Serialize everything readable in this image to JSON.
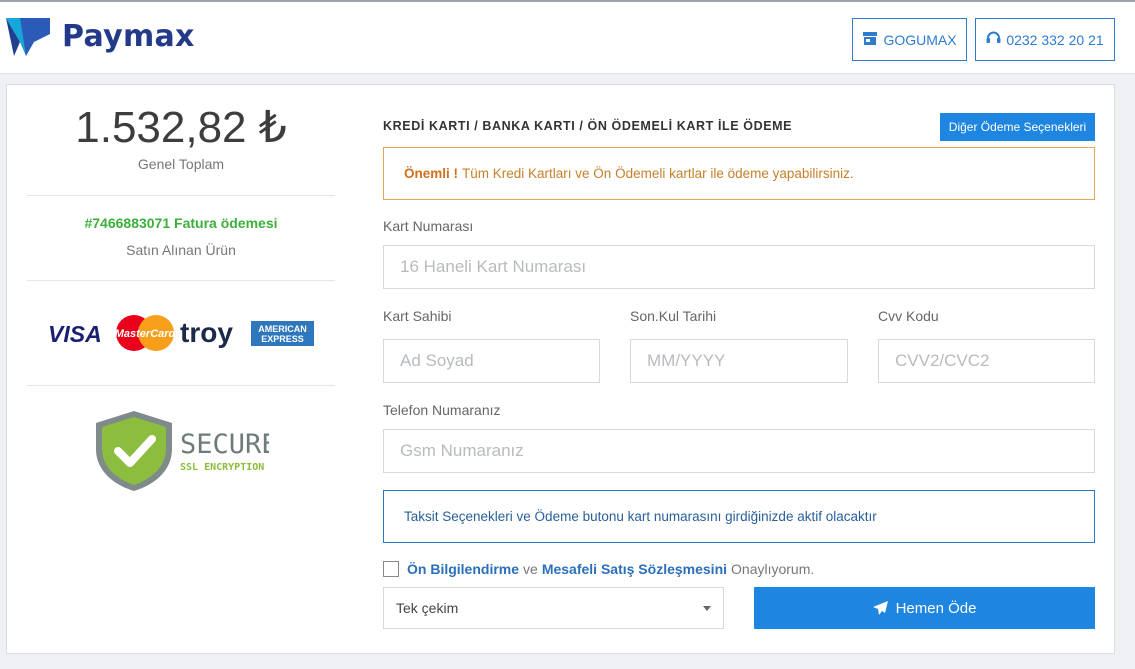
{
  "header": {
    "brand": "Paymax",
    "store_button": "GOGUMAX",
    "store_icon": "store-icon",
    "phone_button": "0232 332 20 21",
    "phone_icon": "headset-icon",
    "accent_color": "#1e85e0"
  },
  "summary": {
    "amount": "1.532,82 ₺",
    "amount_label": "Genel Toplam",
    "invoice": "#7466883071 Fatura ödemesi",
    "product_label": "Satın Alınan Ürün",
    "card_brands": [
      "VISA",
      "MasterCard",
      "troy",
      "AMERICAN",
      "EXPRESS"
    ],
    "secure_title": "SECURE",
    "secure_sub": "SSL ENCRYPTION"
  },
  "payment": {
    "title": "KREDİ KARTI / BANKA KARTI / ÖN ÖDEMELİ KART İLE ÖDEME",
    "alt_button": "Diğer Ödeme Seçenekleri",
    "alert_strong": "Önemli !",
    "alert_text": "Tüm Kredi Kartları ve Ön Ödemeli kartlar ile ödeme yapabilirsiniz.",
    "card_number_label": "Kart Numarası",
    "card_number_placeholder": "16 Haneli Kart Numarası",
    "holder_label": "Kart Sahibi",
    "holder_placeholder": "Ad Soyad",
    "expiry_label": "Son.Kul Tarihi",
    "expiry_placeholder": "MM/YYYY",
    "cvv_label": "Cvv Kodu",
    "cvv_placeholder": "CVV2/CVC2",
    "phone_label": "Telefon Numaranız",
    "phone_placeholder": "Gsm Numaranız",
    "info_text": "Taksit Seçenekleri ve Ödeme butonu kart numarasını girdiğinizde aktif olacaktır",
    "agree_link1": "Ön Bilgilendirme",
    "agree_mid": "ve",
    "agree_link2": "Mesafeli Satış Sözleşmesini",
    "agree_tail": "Onaylıyorum.",
    "installment_selected": "Tek çekim",
    "pay_button": "Hemen Öde"
  }
}
